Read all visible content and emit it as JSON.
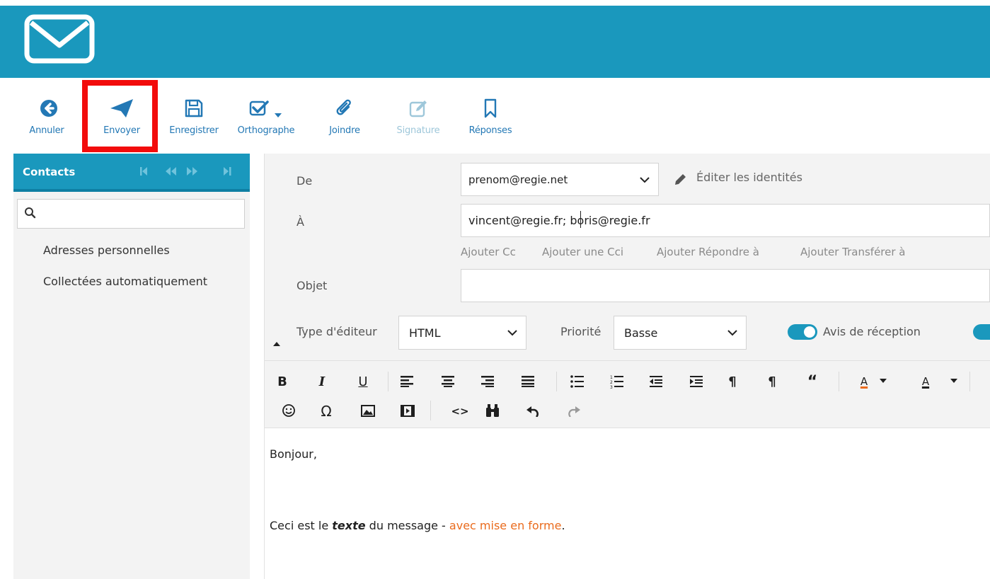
{
  "colors": {
    "brand": "#1a98bd",
    "highlight": "#f20c0c",
    "link": "#2378b5",
    "accent_text": "#ea6b1d"
  },
  "header": {
    "logo_icon": "envelope-icon"
  },
  "toolbar": {
    "cancel": "Annuler",
    "send": "Envoyer",
    "save": "Enregistrer",
    "spell": "Orthographe",
    "attach": "Joindre",
    "signature": "Signature",
    "responses": "Réponses"
  },
  "sidebar": {
    "title": "Contacts",
    "search_placeholder": "",
    "items": [
      "Adresses personnelles",
      "Collectées automatiquement"
    ]
  },
  "compose": {
    "from_label": "De",
    "from_value": "prenom@regie.net",
    "edit_identities": "Éditer les identités",
    "to_label": "À",
    "to_value": "vincent@regie.fr; boris@regie.fr",
    "add_links": [
      "Ajouter Cc",
      "Ajouter une Cci",
      "Ajouter Répondre à",
      "Ajouter Transférer à"
    ],
    "subject_label": "Objet",
    "subject_value": "",
    "editor_type_label": "Type d'éditeur",
    "editor_type_value": "HTML",
    "priority_label": "Priorité",
    "priority_value": "Basse",
    "receipt_label": "Avis de réception"
  },
  "editor": {
    "greeting": "Bonjour,",
    "line_prefix": "Ceci est le",
    "line_bold": "texte",
    "line_middle": " du message - ",
    "line_colored": "avec mise en forme",
    "line_end": "."
  }
}
